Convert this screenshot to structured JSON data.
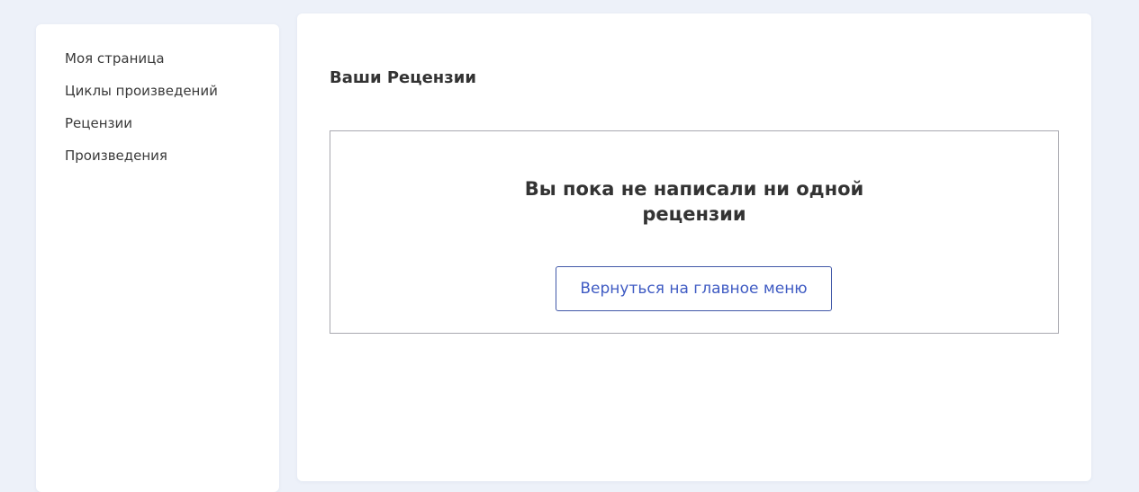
{
  "sidebar": {
    "items": [
      {
        "label": "Моя страница"
      },
      {
        "label": "Циклы произведений"
      },
      {
        "label": "Рецензии"
      },
      {
        "label": "Произведения"
      }
    ]
  },
  "main": {
    "title": "Ваши Рецензии",
    "empty_state": {
      "message": "Вы пока не написали ни одной рецензии",
      "button_label": "Вернуться на главное меню"
    }
  },
  "colors": {
    "page_background": "#edf1f9",
    "panel_background": "#ffffff",
    "text": "#333333",
    "button_accent": "#3f5bc3",
    "box_border": "#a9a9b0"
  }
}
